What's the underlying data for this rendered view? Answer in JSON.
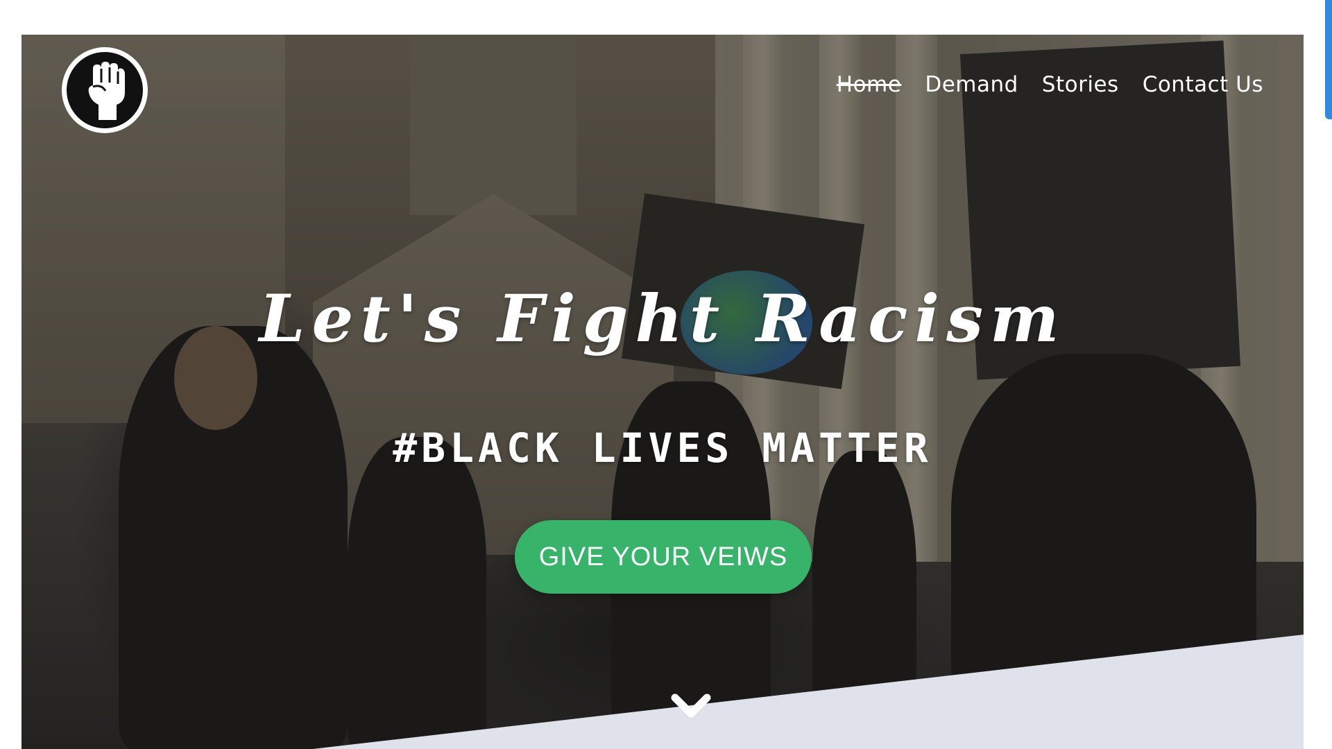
{
  "nav": {
    "items": [
      {
        "label": "Home",
        "active": true
      },
      {
        "label": "Demand",
        "active": false
      },
      {
        "label": "Stories",
        "active": false
      },
      {
        "label": "Contact Us",
        "active": false
      }
    ]
  },
  "hero": {
    "headline": "Let's Fight Racism",
    "subheadline": "#BLACK LIVES MATTER",
    "cta_label": "GIVE YOUR VEIWS",
    "logo_icon": "raised-fist-icon",
    "scroll_icon": "chevron-down-icon"
  },
  "colors": {
    "cta": "#37b36a",
    "nav_text": "#ffffff",
    "section_bg": "#dfe2ea",
    "scroll_indicator": "#2f8ae0"
  }
}
